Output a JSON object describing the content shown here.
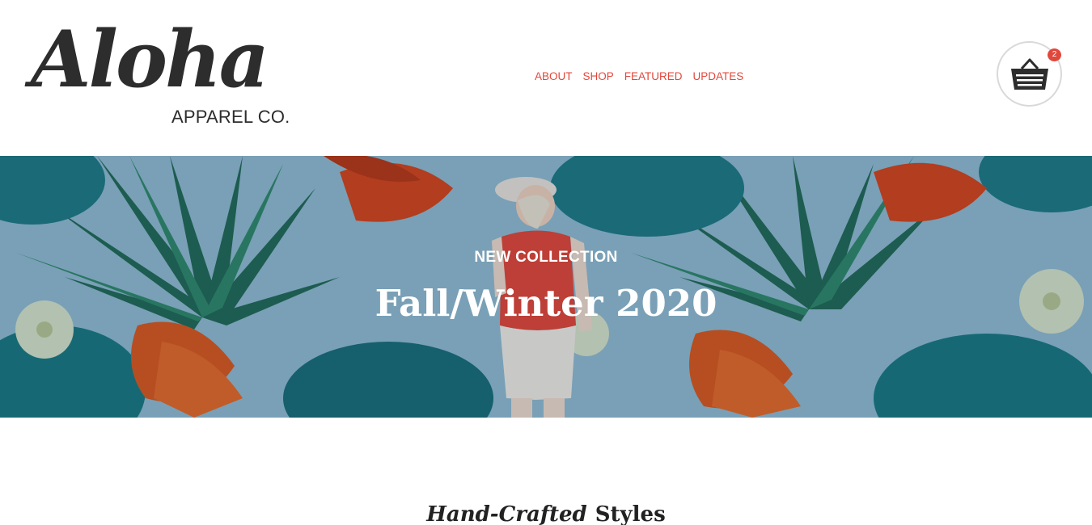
{
  "header": {
    "logo": {
      "script_text": "Aloha",
      "subtext": "APPAREL CO."
    },
    "nav": [
      {
        "label": "ABOUT"
      },
      {
        "label": "SHOP"
      },
      {
        "label": "FEATURED"
      },
      {
        "label": "UPDATES"
      }
    ],
    "cart": {
      "icon": "basket-icon",
      "count": "2"
    }
  },
  "hero": {
    "kicker": "NEW COLLECTION",
    "title": "Fall/Winter 2020"
  },
  "section": {
    "heading_italic": "Hand-Crafted",
    "heading_bold": "Styles"
  },
  "colors": {
    "accent": "#e2473b",
    "text_dark": "#2d2d2d",
    "hero_sky": "#8fbdd6"
  }
}
